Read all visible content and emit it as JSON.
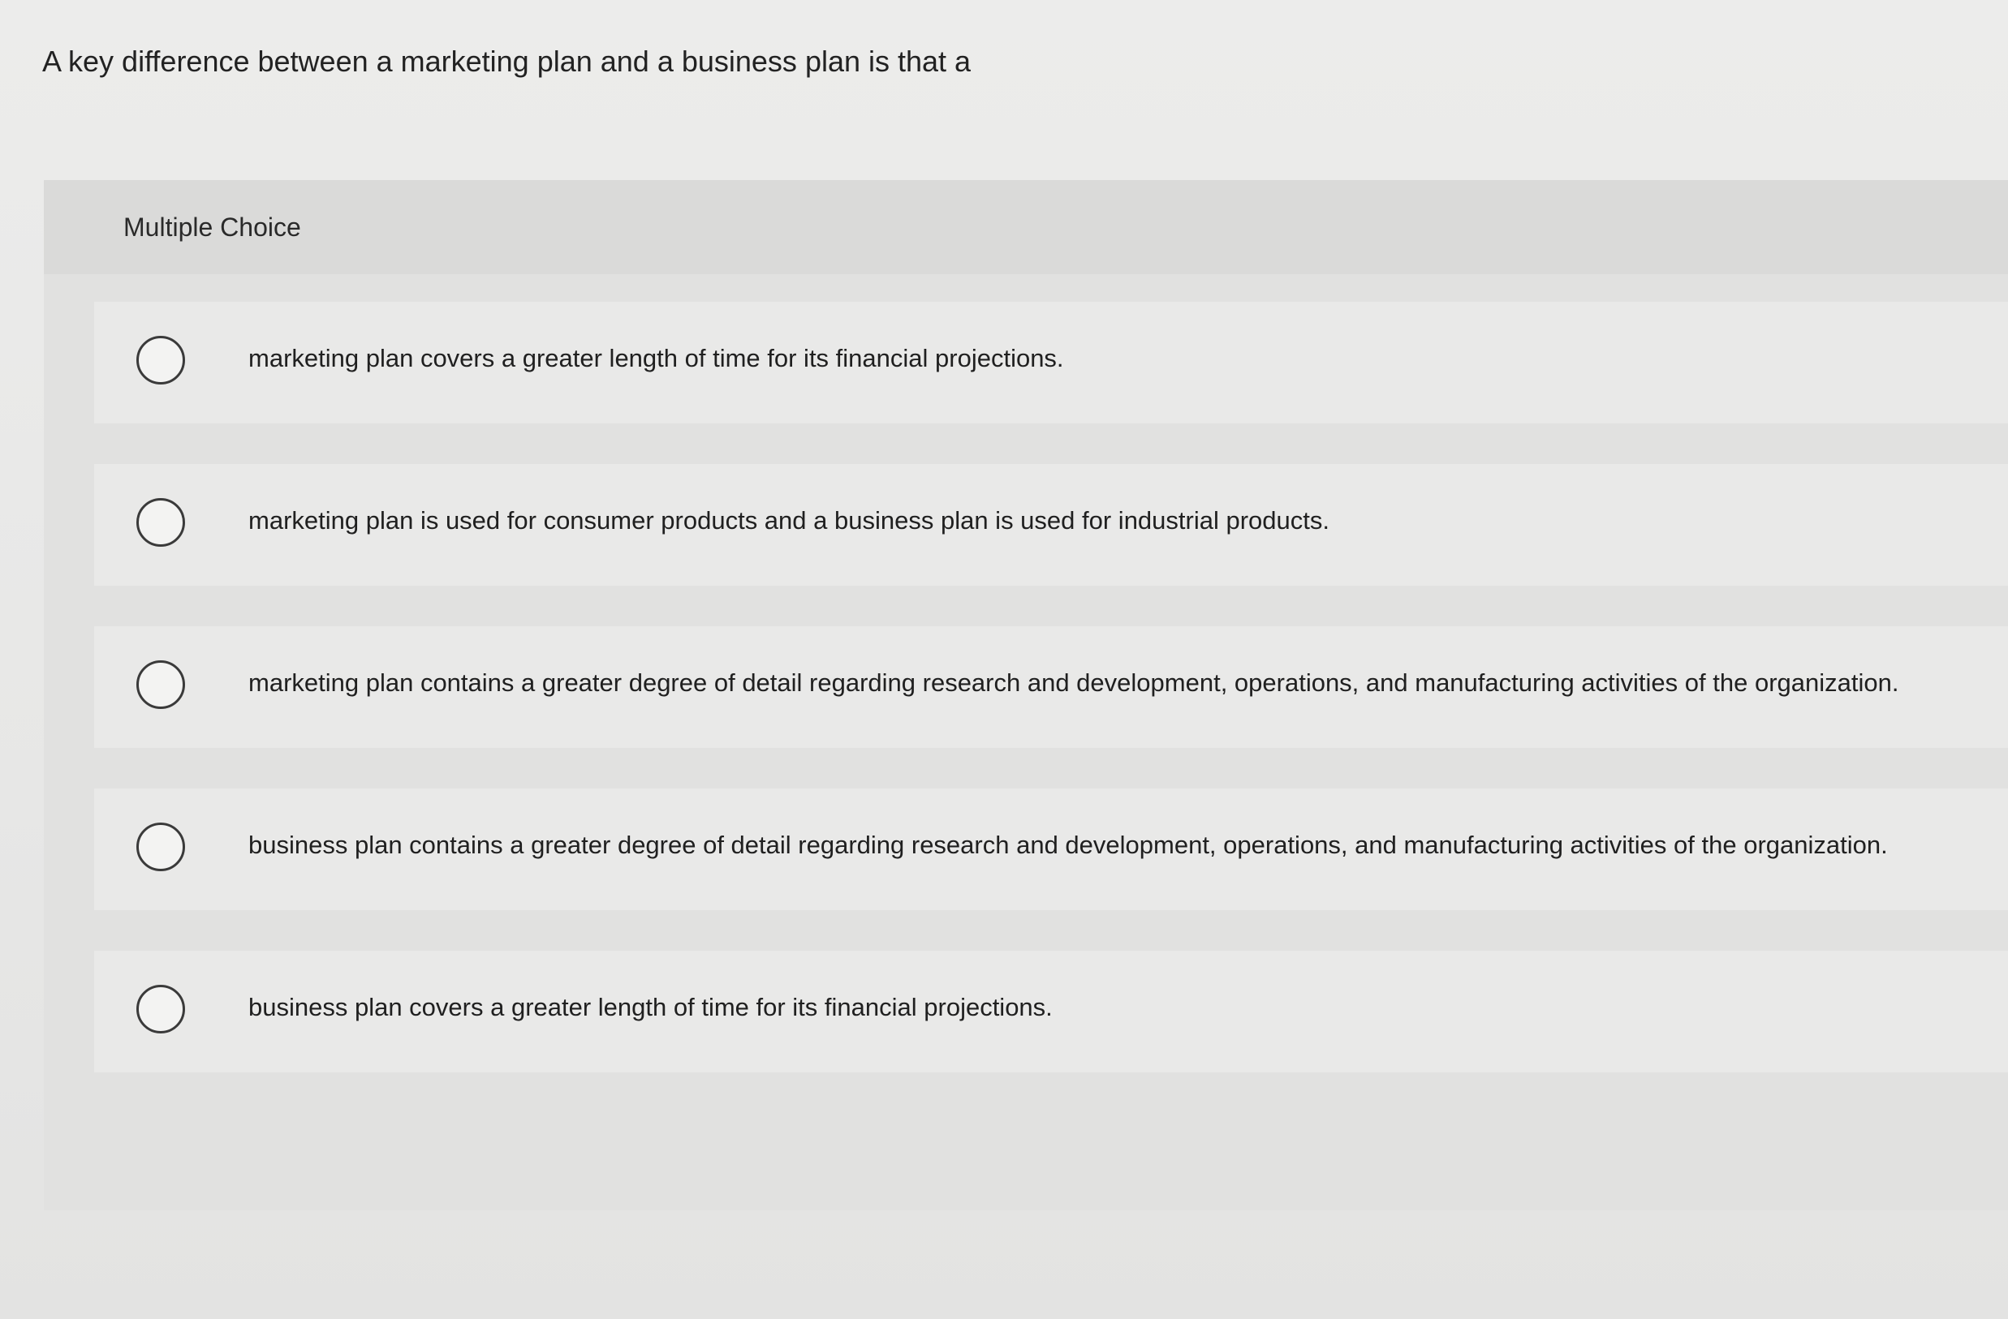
{
  "question": {
    "text": "A key difference between a marketing plan and a business plan is that a"
  },
  "multiple_choice": {
    "label": "Multiple Choice",
    "options": [
      {
        "text": "marketing plan covers a greater length of time for its financial projections.",
        "selected": false
      },
      {
        "text": "marketing plan is used for consumer products and a business plan is used for industrial products.",
        "selected": false
      },
      {
        "text": "marketing plan contains a greater degree of detail regarding research and development, operations, and manufacturing activities of the organization.",
        "selected": false
      },
      {
        "text": "business plan contains a greater degree of detail regarding research and development, operations, and manufacturing activities of the organization.",
        "selected": false
      },
      {
        "text": "business plan covers a greater length of time for its financial projections.",
        "selected": false
      }
    ]
  }
}
